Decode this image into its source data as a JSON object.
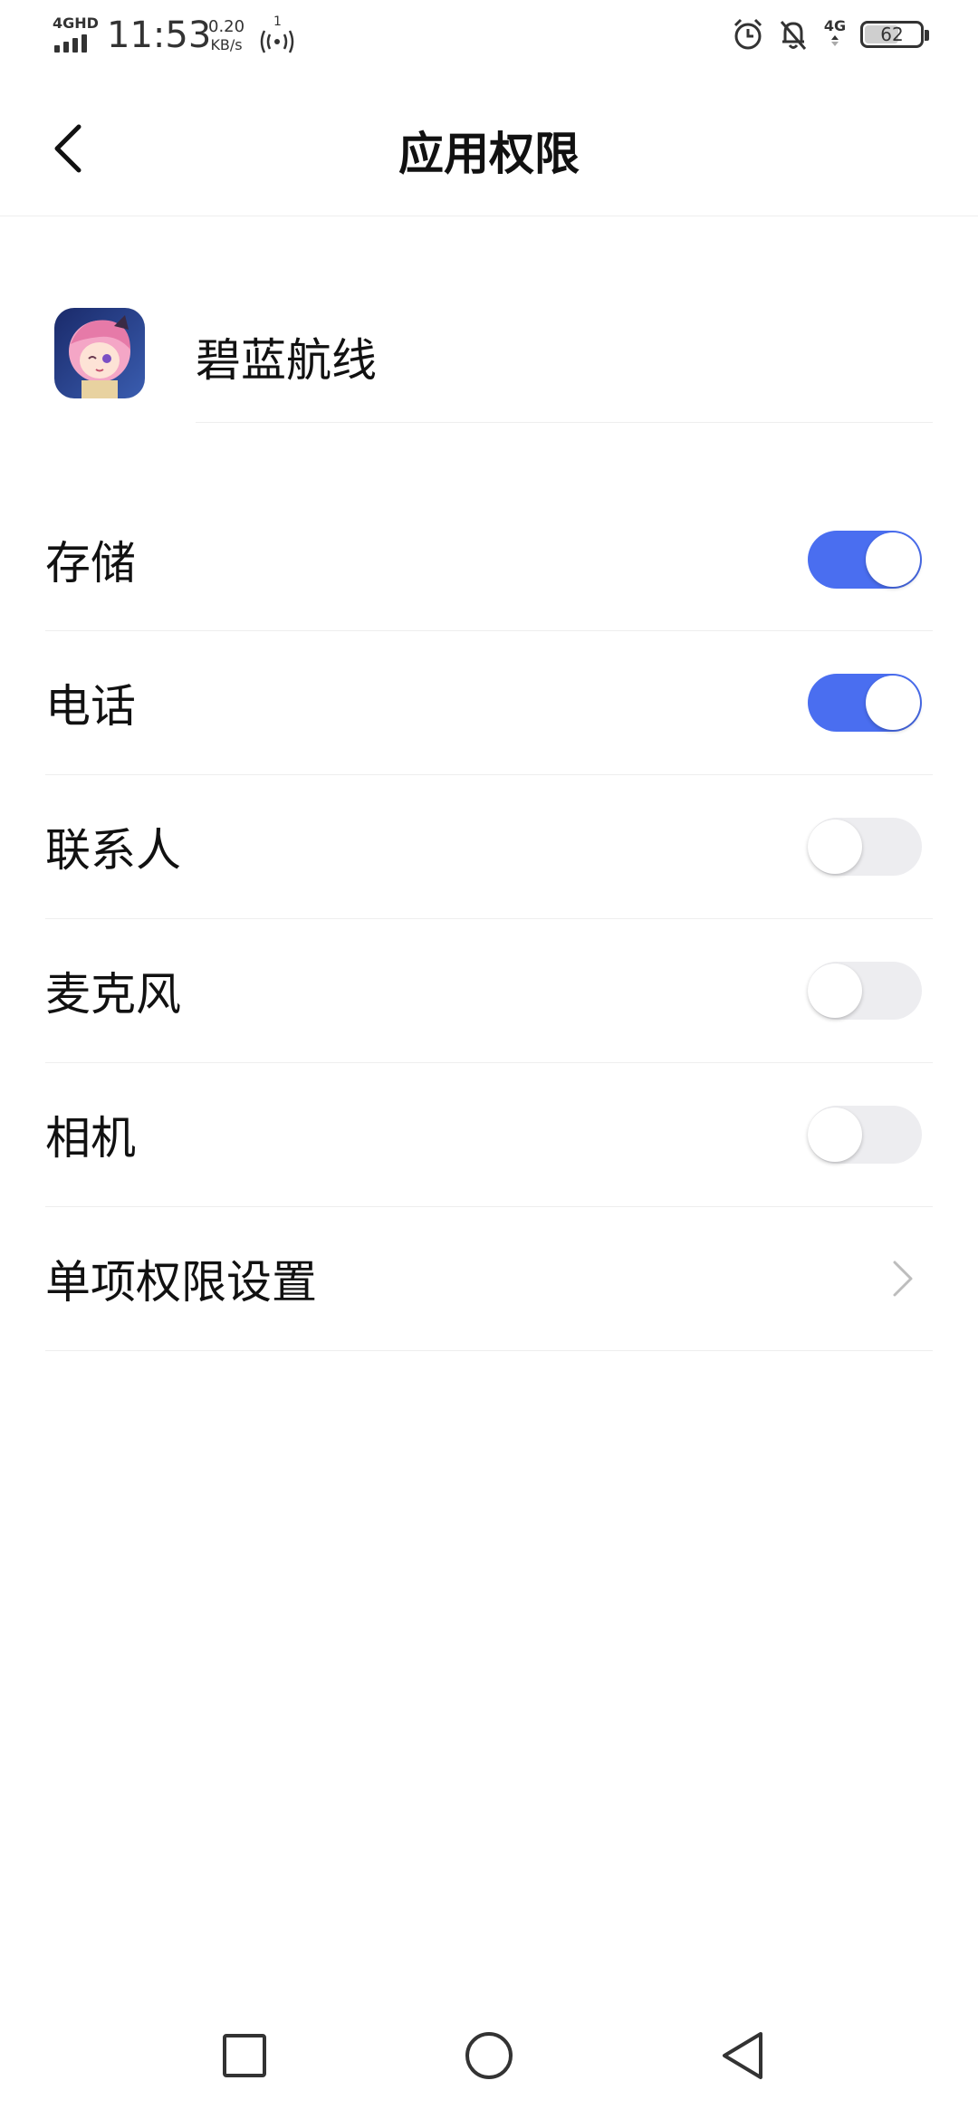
{
  "status_bar": {
    "network_label": "4GHD",
    "time": "11:53",
    "speed_value": "0.20",
    "speed_unit": "KB/s",
    "hotspot_count": "1",
    "network_type": "4G",
    "battery_level": "62"
  },
  "header": {
    "title": "应用权限",
    "back_icon": "chevron-left-icon"
  },
  "app": {
    "name": "碧蓝航线",
    "icon": "app-icon"
  },
  "permissions": [
    {
      "label": "存储",
      "enabled": true
    },
    {
      "label": "电话",
      "enabled": true
    },
    {
      "label": "联系人",
      "enabled": false
    },
    {
      "label": "麦克风",
      "enabled": false
    },
    {
      "label": "相机",
      "enabled": false
    }
  ],
  "individual_settings": {
    "label": "单项权限设置",
    "icon": "chevron-right-icon"
  },
  "nav": {
    "recent_icon": "square-icon",
    "home_icon": "circle-icon",
    "back_icon": "triangle-back-icon"
  },
  "colors": {
    "accent": "#4a6ef0",
    "toggle_off": "#ededf0",
    "divider": "#eeeeee",
    "text": "#111111"
  }
}
